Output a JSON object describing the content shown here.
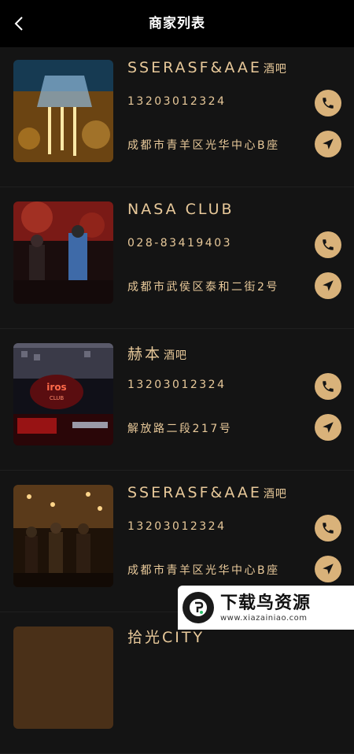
{
  "header": {
    "title": "商家列表",
    "back_icon": "chevron-left-icon"
  },
  "colors": {
    "accent": "#e8c99a",
    "button": "#d9b27a",
    "background": "#141414"
  },
  "merchants": [
    {
      "name": "SSERASF&AAE",
      "suffix": "酒吧",
      "phone": "13203012324",
      "address": "成都市青羊区光华中心B座"
    },
    {
      "name": "NASA CLUB",
      "suffix": "",
      "phone": "028-83419403",
      "address": "成都市武侯区泰和二街2号"
    },
    {
      "name": "赫本",
      "suffix": "酒吧",
      "phone": "13203012324",
      "address": "解放路二段217号"
    },
    {
      "name": "SSERASF&AAE",
      "suffix": "酒吧",
      "phone": "13203012324",
      "address": "成都市青羊区光华中心B座"
    },
    {
      "name": "拾光CITY",
      "suffix": "",
      "phone": "",
      "address": ""
    }
  ],
  "watermark": {
    "name": "下载鸟资源",
    "url": "www.xiazainiao.com"
  }
}
